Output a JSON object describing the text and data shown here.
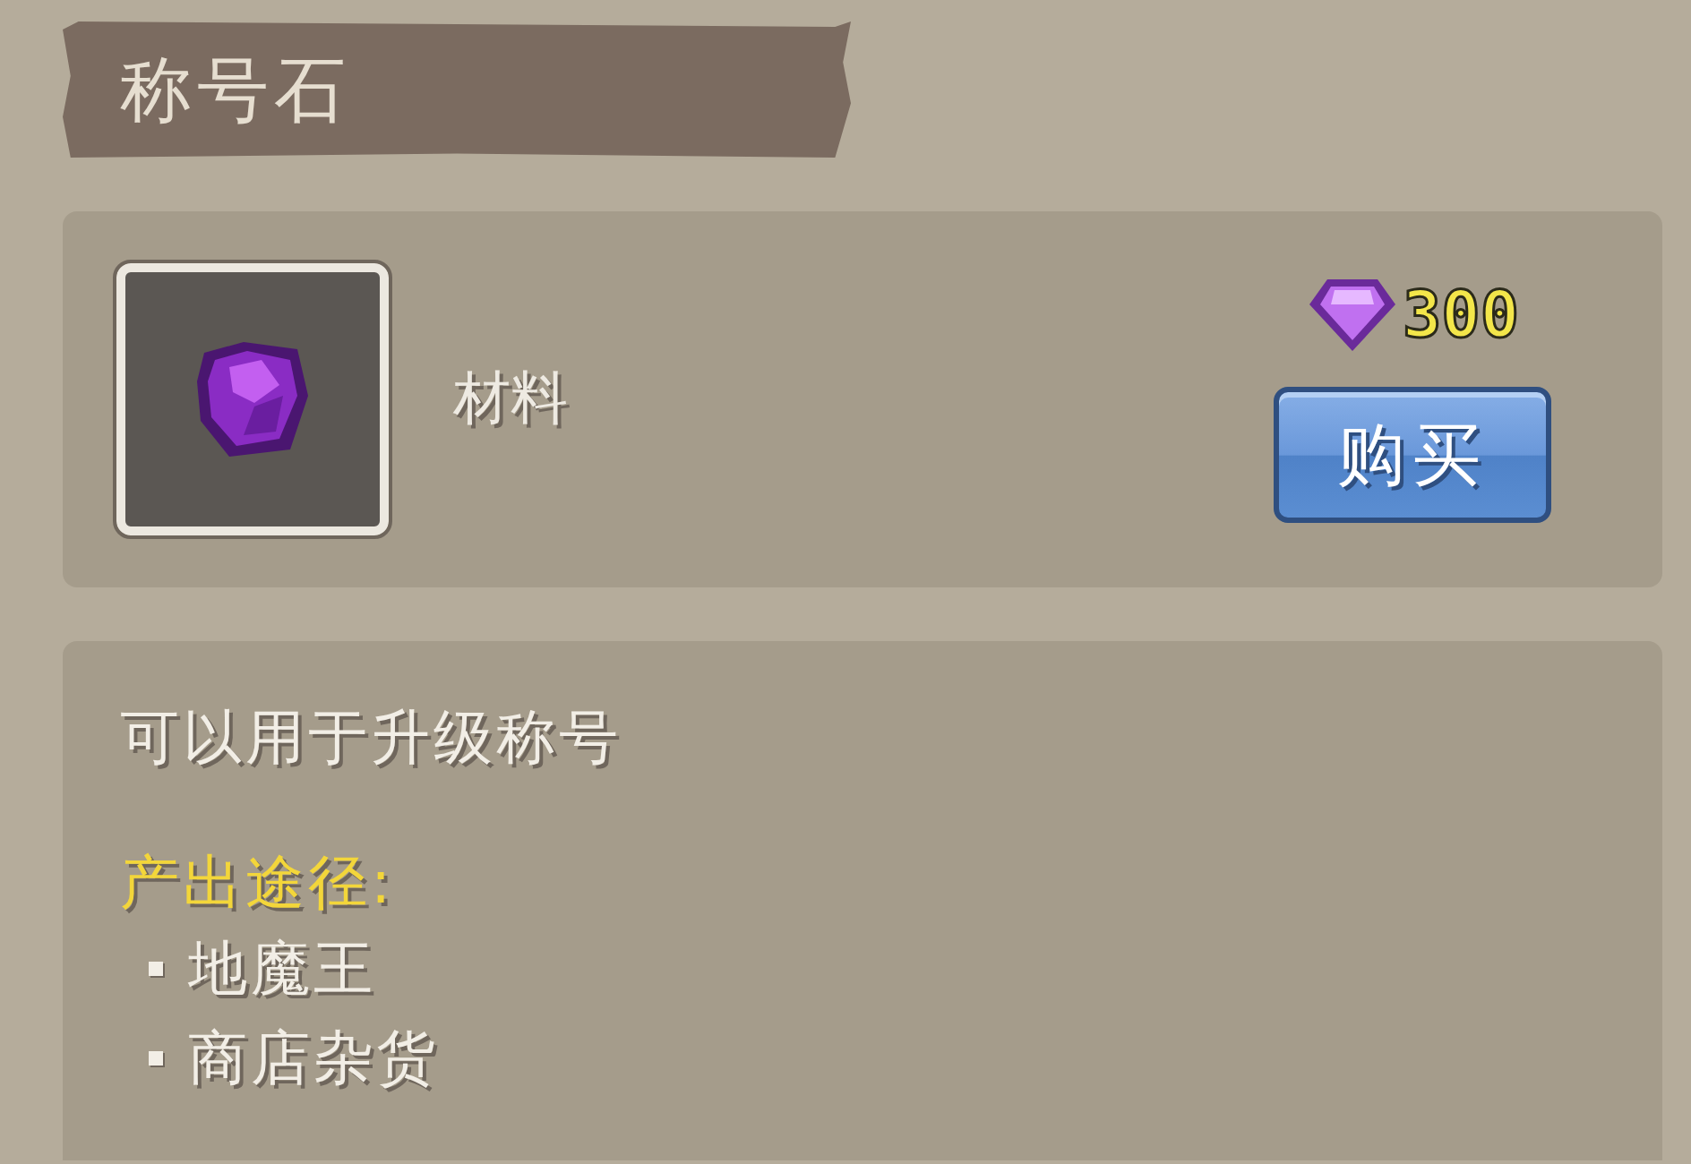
{
  "title": "称号石",
  "item": {
    "category": "材料",
    "price": "300",
    "buy_button": "购买"
  },
  "description": {
    "text": "可以用于升级称号",
    "sources_label": "产出途径:",
    "sources": [
      "地魔王",
      "商店杂货"
    ]
  }
}
